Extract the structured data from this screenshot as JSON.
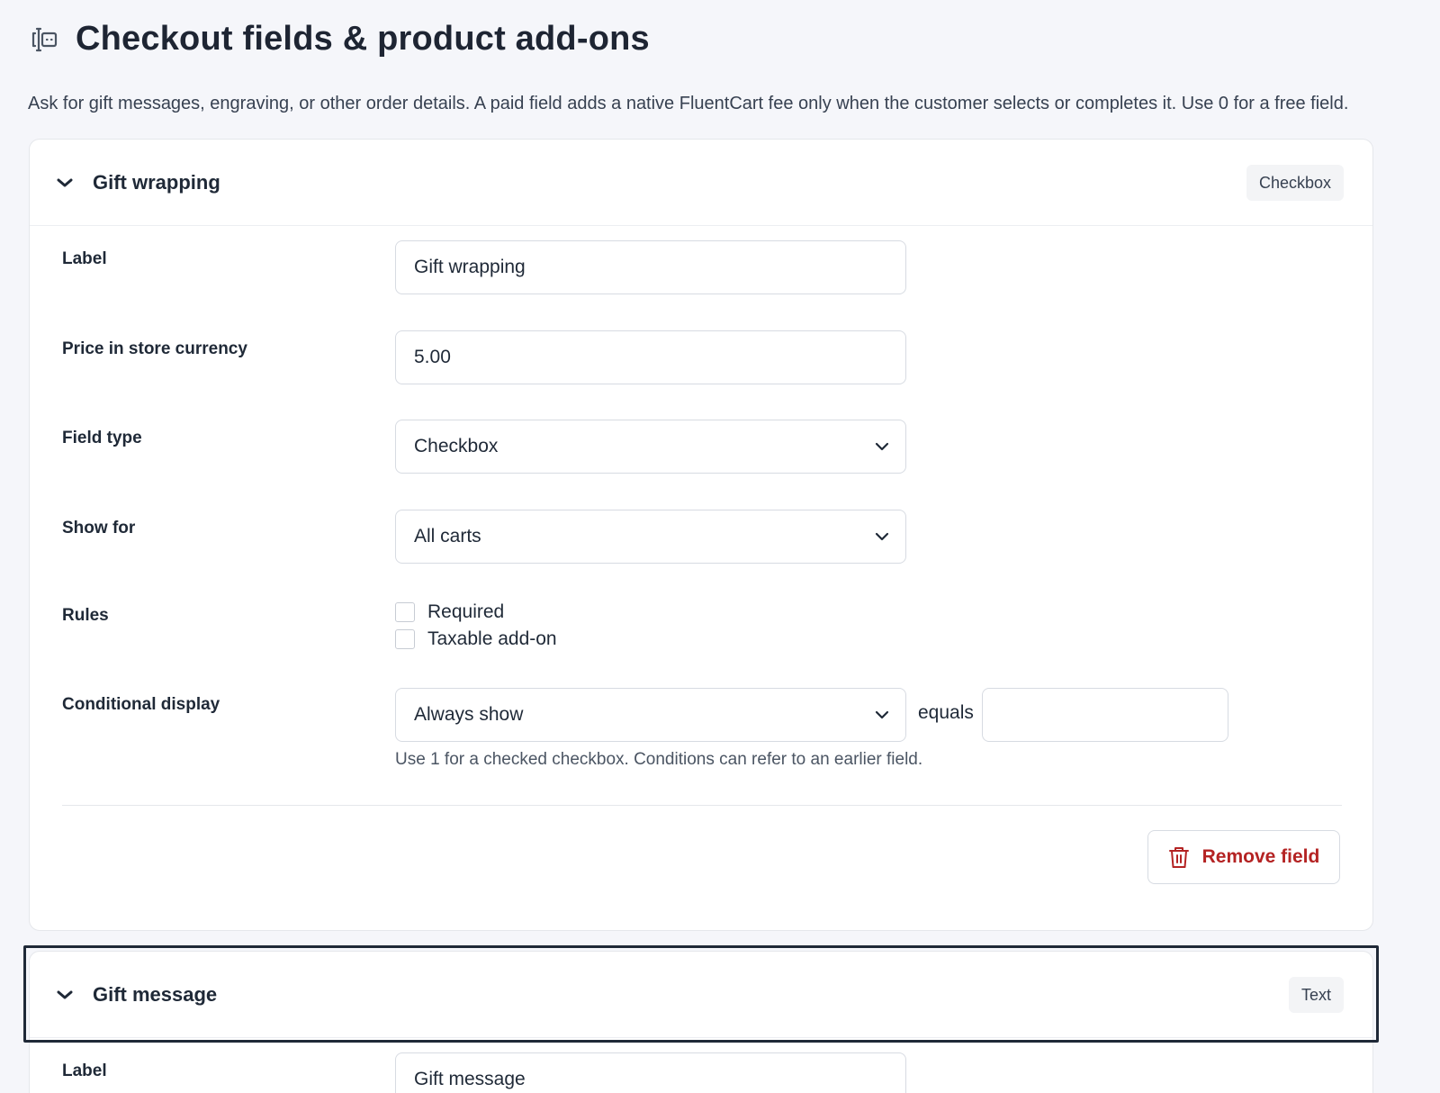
{
  "header": {
    "title": "Checkout fields & product add-ons",
    "icon": "text-cursor-icon"
  },
  "intro": "Ask for gift messages, engraving, or other order details. A paid field adds a native FluentCart fee only when the customer selects or completes it. Use 0 for a free field.",
  "fields": [
    {
      "title": "Gift wrapping",
      "type_badge": "Checkbox",
      "label_label": "Label",
      "label_value": "Gift wrapping",
      "price_label": "Price in store currency",
      "price_value": "5.00",
      "type_label": "Field type",
      "type_value": "Checkbox",
      "show_for_label": "Show for",
      "show_for_value": "All carts",
      "rules_label": "Rules",
      "rule_required": "Required",
      "rule_taxable": "Taxable add-on",
      "cond_label": "Conditional display",
      "cond_value": "Always show",
      "equals_label": "equals",
      "equals_value": "",
      "help": "Use 1 for a checked checkbox. Conditions can refer to an earlier field.",
      "remove_label": "Remove field"
    },
    {
      "title": "Gift message",
      "type_badge": "Text",
      "label_label": "Label",
      "label_value": "Gift message"
    }
  ],
  "colors": {
    "background": "#f5f6fa",
    "danger": "#b42323",
    "focus": "#1f2937"
  }
}
